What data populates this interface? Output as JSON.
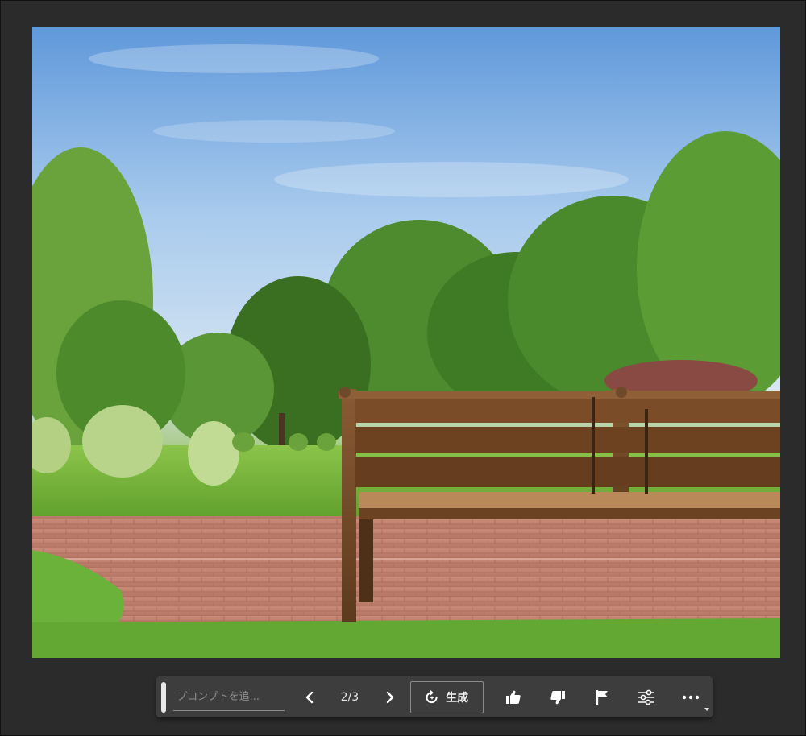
{
  "canvas": {
    "image_description_icon": "generated-image"
  },
  "taskbar": {
    "prompt_placeholder": "プロンプトを追...",
    "counter": "2/3",
    "generate_label": "生成",
    "icons": {
      "prev": "chevron-left-icon",
      "next": "chevron-right-icon",
      "generate": "refresh-sparkle-icon",
      "like": "thumbs-up-icon",
      "dislike": "thumbs-down-icon",
      "report": "flag-icon",
      "settings": "sliders-icon",
      "more": "more-icon"
    }
  },
  "colors": {
    "background": "#2b2b2b",
    "taskbar": "#3d3d3d",
    "icon": "#ffffff"
  }
}
